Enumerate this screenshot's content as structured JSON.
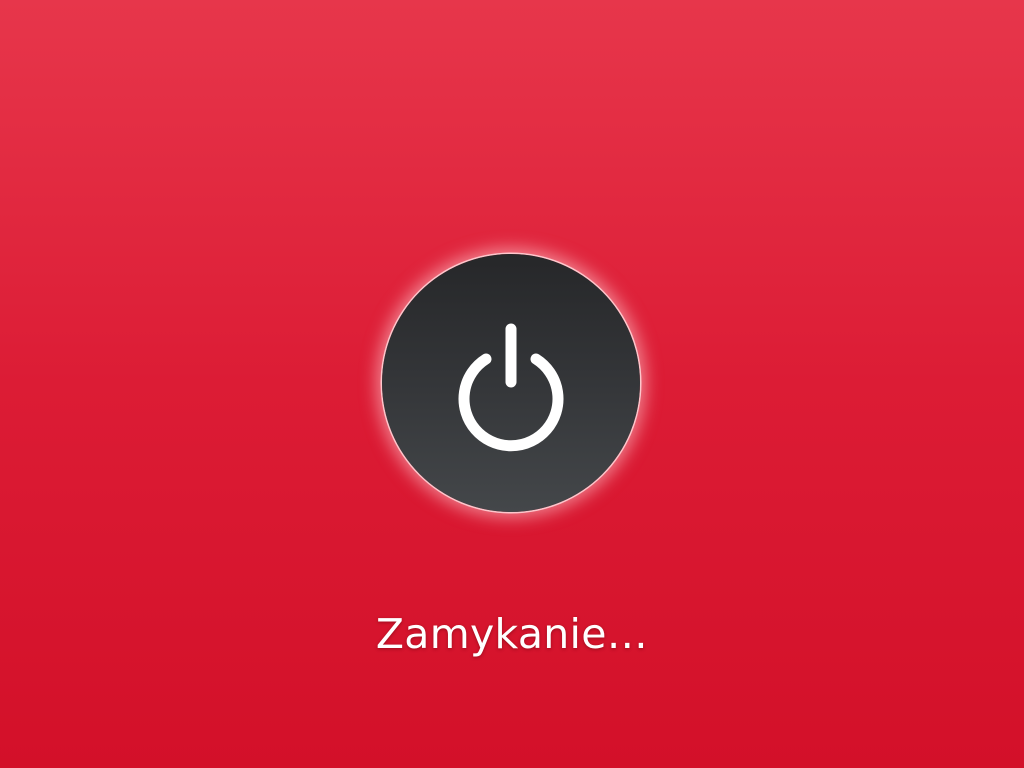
{
  "screen": {
    "status_text": "Zamykanie…",
    "icon": "power-icon"
  },
  "colors": {
    "background_top": "#e7364b",
    "background_bottom": "#d31029",
    "button_fill": "#343639",
    "icon_stroke": "#ffffff"
  }
}
